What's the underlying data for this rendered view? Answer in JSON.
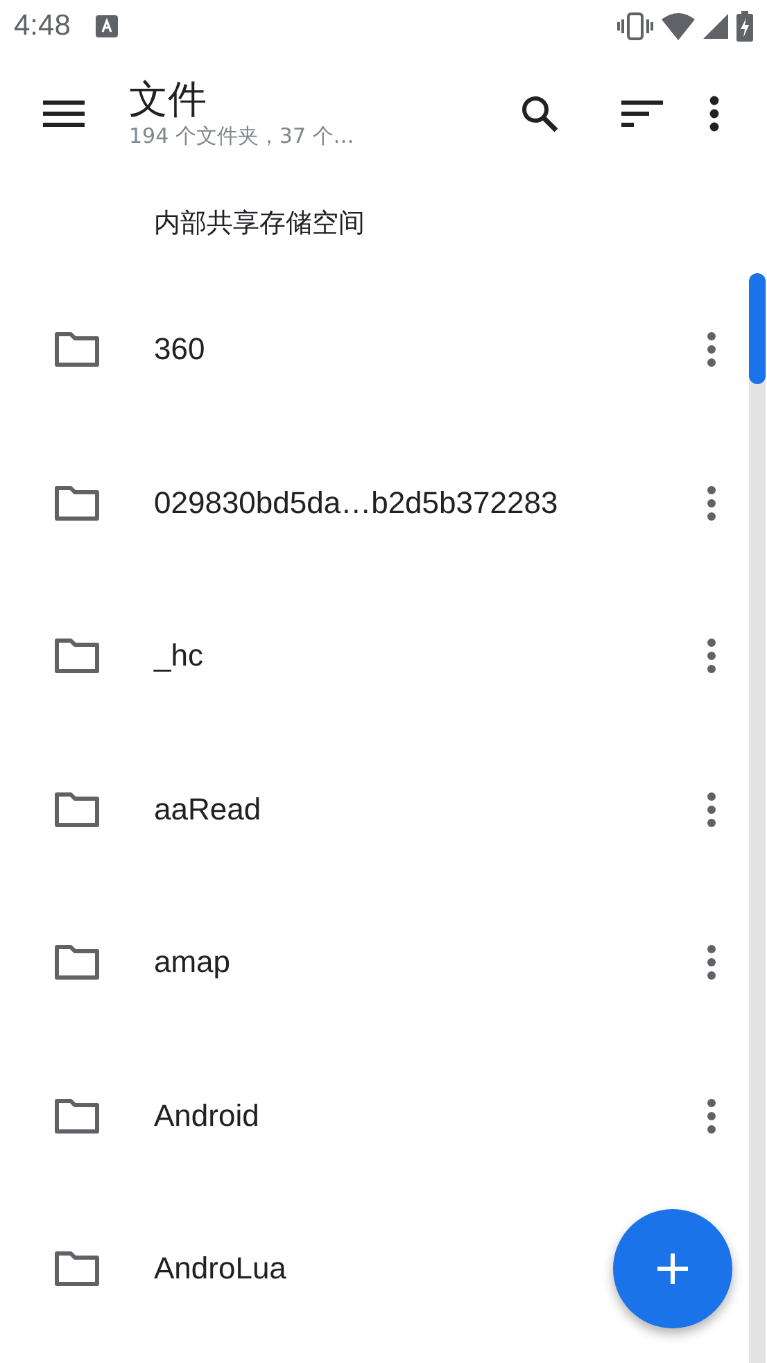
{
  "status_bar": {
    "time": "4:48"
  },
  "app_bar": {
    "title": "文件",
    "subtitle": "194 个文件夹，37 个…"
  },
  "section_header": "内部共享存储空间",
  "folders": [
    {
      "name": "360"
    },
    {
      "name": "029830bd5da…b2d5b372283"
    },
    {
      "name": "_hc"
    },
    {
      "name": "aaRead"
    },
    {
      "name": "amap"
    },
    {
      "name": "Android"
    },
    {
      "name": "AndroLua"
    }
  ]
}
